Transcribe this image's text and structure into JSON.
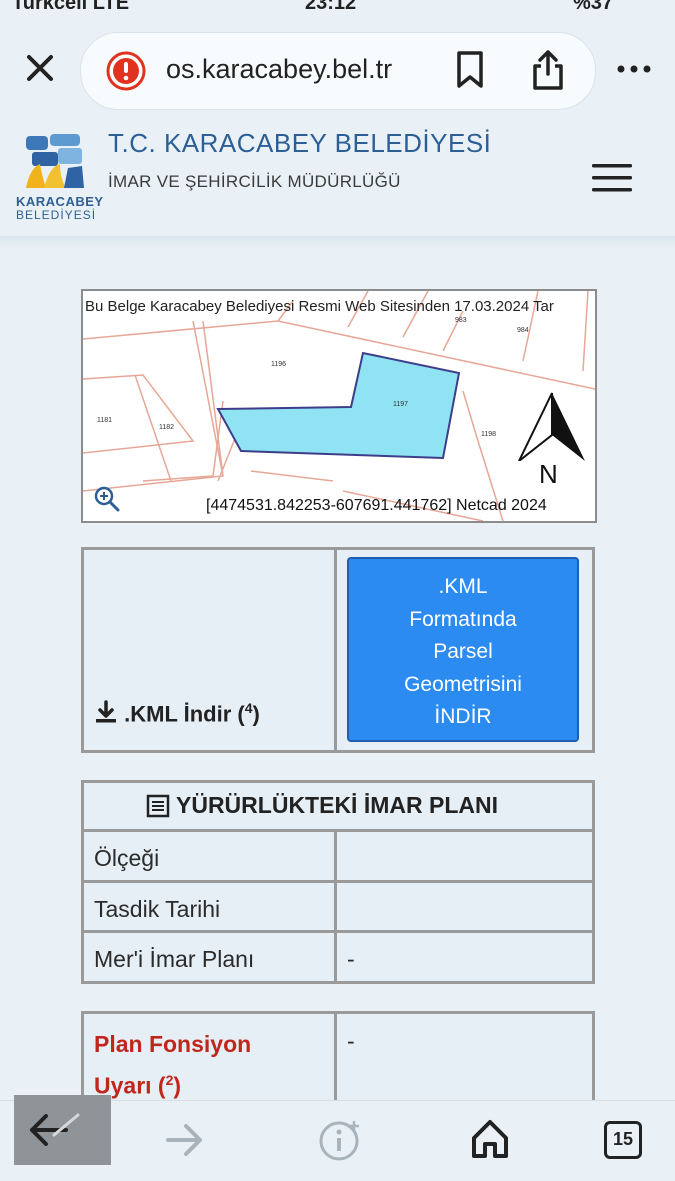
{
  "status_bar": {
    "carrier": "Turkcell LTE",
    "time": "23:12",
    "battery": "%37"
  },
  "browser": {
    "url": "os.karacabey.bel.tr",
    "tab_count": "15"
  },
  "site": {
    "logo_line1": "KARACABEY",
    "logo_line2": "BELEDİYESİ",
    "title": "T.C. KARACABEY BELEDİYESİ",
    "subtitle": "İMAR VE ŞEHİRCİLİK MÜDÜRLÜĞÜ"
  },
  "map": {
    "caption": "Bu Belge Karacabey Belediyesi Resmi Web Sitesinden 17.03.2024 Tar",
    "coords": "[4474531.842253-607691.441762] Netcad 2024",
    "north_label": "N",
    "parcel_labels": [
      "1196",
      "1197",
      "1181",
      "1182",
      "1198",
      "983",
      "984"
    ],
    "parcel_color": "#8fe3f2"
  },
  "kml": {
    "download_label": ".KML İndir (",
    "download_sup": "4",
    "download_close": ")",
    "button_lines": [
      ".KML",
      "Formatında",
      "Parsel",
      "Geometrisini",
      "İNDİR"
    ],
    "button_color": "#2b8bf0"
  },
  "plan": {
    "heading": "YÜRÜRLÜKTEKİ İMAR PLANI",
    "rows": [
      {
        "label": "Ölçeği",
        "value": ""
      },
      {
        "label": "Tasdik Tarihi",
        "value": ""
      },
      {
        "label": "Mer'i İmar Planı",
        "value": "-"
      }
    ]
  },
  "warning": {
    "label_line1": "Plan Fonsiyon",
    "label_line2": "Uyarı (",
    "label_sup": "2",
    "label_close": ")",
    "value": "-",
    "color": "#c0271c"
  }
}
